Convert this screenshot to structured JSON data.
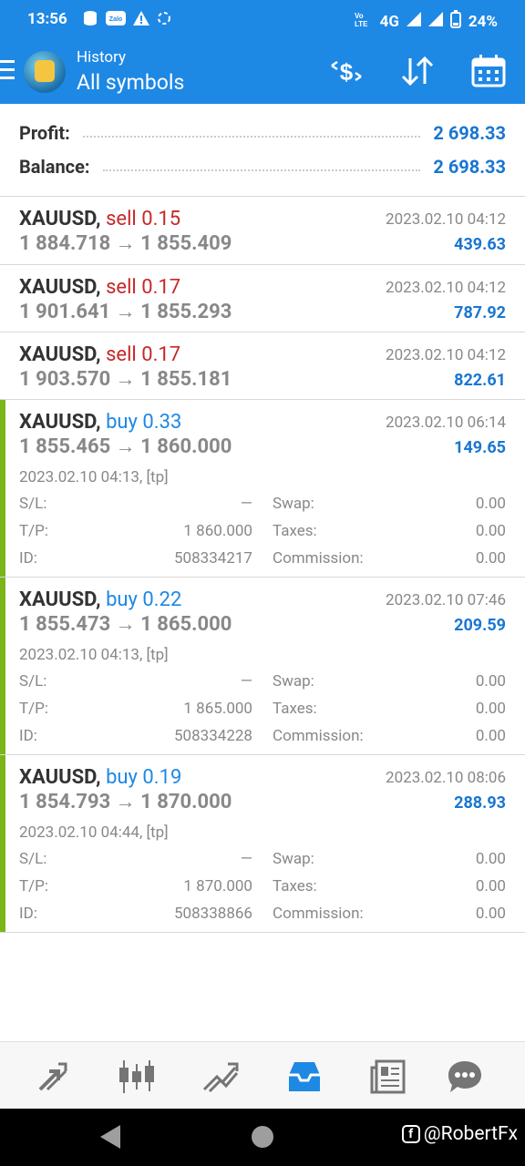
{
  "status_bar": {
    "time": "13:56",
    "network": "4G",
    "battery": "24%",
    "notification_icons": [
      "database-icon",
      "zalo-icon",
      "warning-icon",
      "sync-icon"
    ]
  },
  "header": {
    "subtitle": "History",
    "title": "All symbols",
    "icons": [
      "currency-filter-icon",
      "sort-icon",
      "calendar-icon"
    ]
  },
  "summary": {
    "profit_label": "Profit:",
    "profit_value": "2 698.33",
    "balance_label": "Balance:",
    "balance_value": "2 698.33"
  },
  "trades": [
    {
      "symbol": "XAUUSD,",
      "action": "sell 0.15",
      "type": "sell",
      "date": "2023.02.10 04:12",
      "prices": "1 884.718 → 1 855.409",
      "profit": "439.63"
    },
    {
      "symbol": "XAUUSD,",
      "action": "sell 0.17",
      "type": "sell",
      "date": "2023.02.10 04:12",
      "prices": "1 901.641 → 1 855.293",
      "profit": "787.92"
    },
    {
      "symbol": "XAUUSD,",
      "action": "sell 0.17",
      "type": "sell",
      "date": "2023.02.10 04:12",
      "prices": "1 903.570 → 1 855.181",
      "profit": "822.61"
    },
    {
      "symbol": "XAUUSD,",
      "action": "buy 0.33",
      "type": "buy",
      "date": "2023.02.10 06:14",
      "prices": "1 855.465 → 1 860.000",
      "profit": "149.65",
      "open_info": "2023.02.10 04:13, [tp]",
      "sl_label": "S/L:",
      "sl": "—",
      "tp_label": "T/P:",
      "tp": "1 860.000",
      "id_label": "ID:",
      "id": "508334217",
      "swap_label": "Swap:",
      "swap": "0.00",
      "taxes_label": "Taxes:",
      "taxes": "0.00",
      "commission_label": "Commission:",
      "commission": "0.00"
    },
    {
      "symbol": "XAUUSD,",
      "action": "buy 0.22",
      "type": "buy",
      "date": "2023.02.10 07:46",
      "prices": "1 855.473 → 1 865.000",
      "profit": "209.59",
      "open_info": "2023.02.10 04:13, [tp]",
      "sl_label": "S/L:",
      "sl": "—",
      "tp_label": "T/P:",
      "tp": "1 865.000",
      "id_label": "ID:",
      "id": "508334228",
      "swap_label": "Swap:",
      "swap": "0.00",
      "taxes_label": "Taxes:",
      "taxes": "0.00",
      "commission_label": "Commission:",
      "commission": "0.00"
    },
    {
      "symbol": "XAUUSD,",
      "action": "buy 0.19",
      "type": "buy",
      "date": "2023.02.10 08:06",
      "prices": "1 854.793 → 1 870.000",
      "profit": "288.93",
      "open_info": "2023.02.10 04:44, [tp]",
      "sl_label": "S/L:",
      "sl": "—",
      "tp_label": "T/P:",
      "tp": "1 870.000",
      "id_label": "ID:",
      "id": "508338866",
      "swap_label": "Swap:",
      "swap": "0.00",
      "taxes_label": "Taxes:",
      "taxes": "0.00",
      "commission_label": "Commission:",
      "commission": "0.00"
    }
  ],
  "bottom_nav": [
    "quotes-icon",
    "chart-icon",
    "trade-icon",
    "history-icon",
    "news-icon",
    "chat-icon"
  ],
  "watermark": "@RobertFx",
  "colors": {
    "accent": "#1e88e5",
    "sell": "#c62828",
    "buy": "#1e88e5",
    "profit": "#1976d2",
    "expanded_bar": "#7cb518"
  }
}
